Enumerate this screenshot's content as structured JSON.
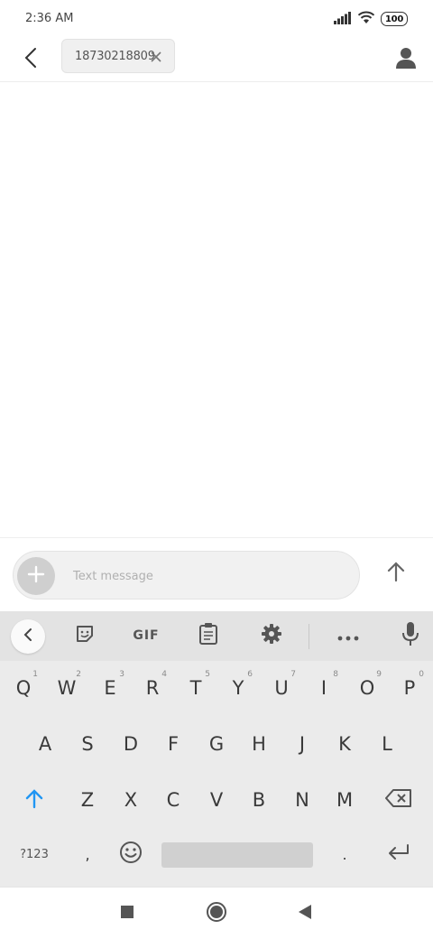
{
  "status_bar": {
    "time": "2:36 AM",
    "battery": "100",
    "icons": [
      "signal-icon",
      "wifi-icon",
      "battery-icon"
    ]
  },
  "header": {
    "recipient_chip": "18730218809",
    "icons": [
      "back-arrow-icon",
      "close-icon",
      "contact-person-icon"
    ]
  },
  "compose": {
    "placeholder": "Text message",
    "icons": [
      "plus-icon",
      "send-arrow-icon"
    ]
  },
  "keyboard": {
    "toolbar": {
      "gif_label": "GIF",
      "icons": [
        "collapse-chevron-icon",
        "sticker-icon",
        "clipboard-icon",
        "gear-icon",
        "more-icon",
        "mic-icon"
      ]
    },
    "row1": [
      {
        "label": "Q",
        "hint": "1"
      },
      {
        "label": "W",
        "hint": "2"
      },
      {
        "label": "E",
        "hint": "3"
      },
      {
        "label": "R",
        "hint": "4"
      },
      {
        "label": "T",
        "hint": "5"
      },
      {
        "label": "Y",
        "hint": "6"
      },
      {
        "label": "U",
        "hint": "7"
      },
      {
        "label": "I",
        "hint": "8"
      },
      {
        "label": "O",
        "hint": "9"
      },
      {
        "label": "P",
        "hint": "0"
      }
    ],
    "row2": [
      "A",
      "S",
      "D",
      "F",
      "G",
      "H",
      "J",
      "K",
      "L"
    ],
    "row3": [
      "Z",
      "X",
      "C",
      "V",
      "B",
      "N",
      "M"
    ],
    "row4": {
      "symbols": "?123",
      "comma": ",",
      "period": "."
    },
    "accent_color": "#2196f3"
  },
  "nav_bar": {
    "icons": [
      "recents-square-icon",
      "home-circle-icon",
      "back-triangle-icon"
    ]
  }
}
